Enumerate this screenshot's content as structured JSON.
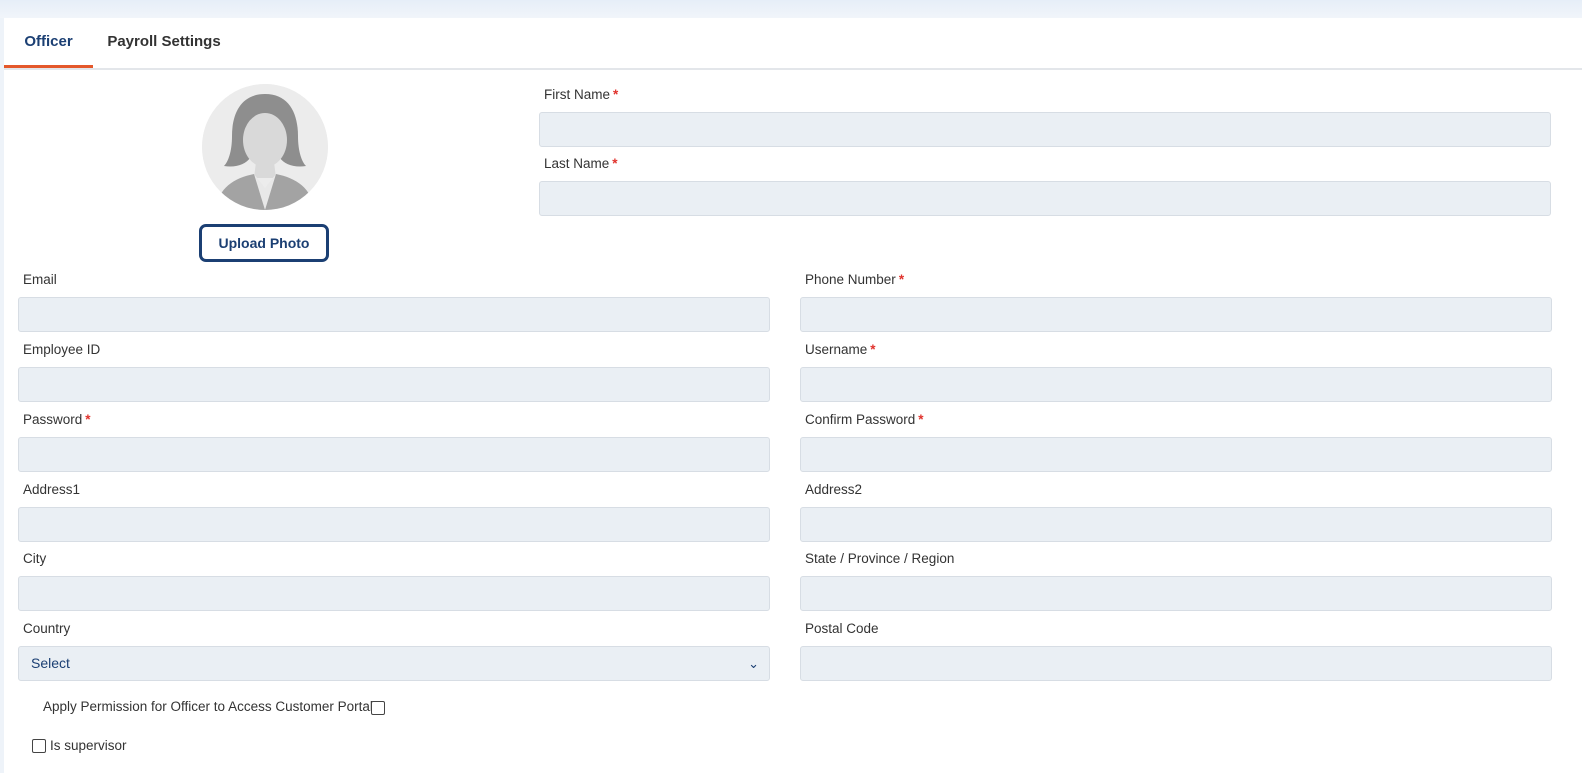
{
  "tabs": {
    "officer": "Officer",
    "payroll": "Payroll Settings"
  },
  "upload_photo": "Upload Photo",
  "required_mark": "*",
  "fields": {
    "first_name": {
      "label": "First Name",
      "value": ""
    },
    "last_name": {
      "label": "Last Name",
      "value": ""
    },
    "email": {
      "label": "Email",
      "value": ""
    },
    "phone": {
      "label": "Phone Number",
      "value": ""
    },
    "employee_id": {
      "label": "Employee ID",
      "value": ""
    },
    "username": {
      "label": "Username",
      "value": ""
    },
    "password": {
      "label": "Password",
      "value": ""
    },
    "confirm_password": {
      "label": "Confirm Password",
      "value": ""
    },
    "address1": {
      "label": "Address1",
      "value": ""
    },
    "address2": {
      "label": "Address2",
      "value": ""
    },
    "city": {
      "label": "City",
      "value": ""
    },
    "state": {
      "label": "State / Province / Region",
      "value": ""
    },
    "country": {
      "label": "Country",
      "selected": "Select"
    },
    "postal": {
      "label": "Postal Code",
      "value": ""
    }
  },
  "checkboxes": {
    "portal": {
      "label": "Apply Permission for Officer to Access Customer Portal",
      "checked": false
    },
    "supervisor": {
      "label": "Is supervisor",
      "checked": false
    }
  },
  "colors": {
    "accent": "#1b3f73",
    "tab_underline": "#e4582b",
    "required": "#e0322c",
    "input_bg": "#eaeff4"
  }
}
